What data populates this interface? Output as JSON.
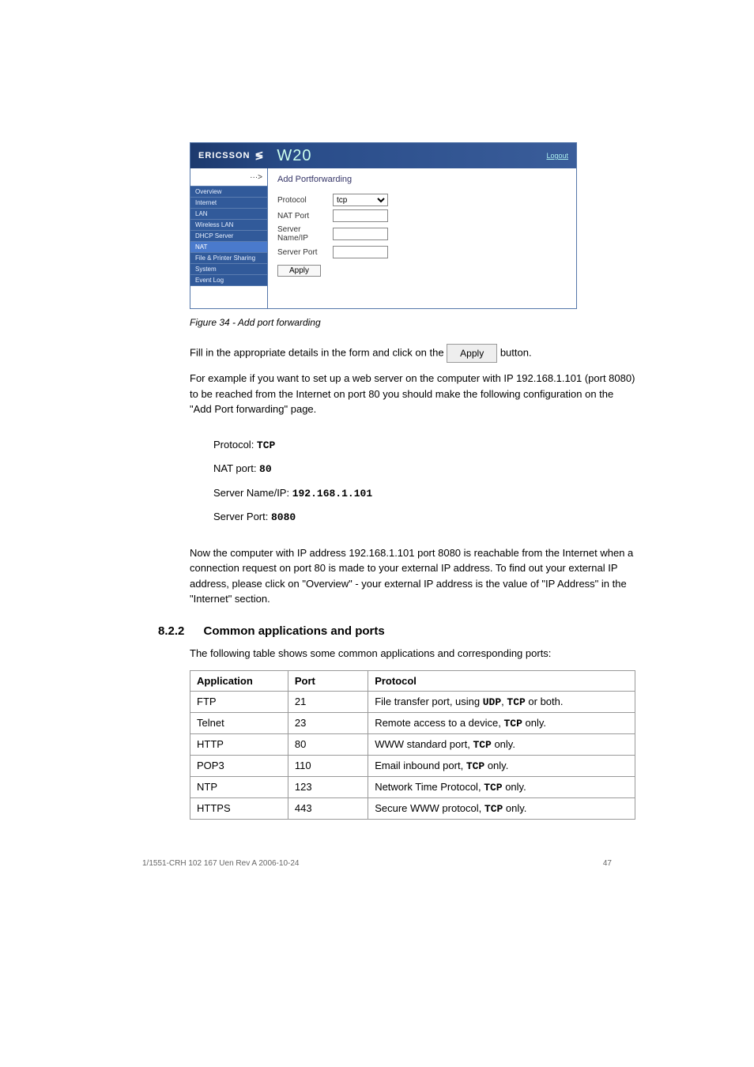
{
  "app": {
    "brand": "ERICSSON",
    "model": "W20",
    "logout": "Logout",
    "breadcrumb_glyph": "···>",
    "nav": [
      "Overview",
      "Internet",
      "LAN",
      "Wireless LAN",
      "DHCP Server",
      "NAT",
      "File & Printer Sharing",
      "System",
      "Event Log"
    ],
    "section_title": "Add Portforwarding",
    "form": {
      "protocol_label": "Protocol",
      "protocol_value": "tcp",
      "nat_port_label": "NAT Port",
      "server_name_label": "Server Name/IP",
      "server_port_label": "Server Port",
      "apply_label": "Apply"
    }
  },
  "caption": "Figure 34 - Add port forwarding",
  "doc": {
    "p1_a": "Fill in the appropriate details in the form and click on the ",
    "p1_btn": "Apply",
    "p1_b": " button.",
    "p2": "For example if you want to set up a web server on the computer with IP 192.168.1.101 (port 8080) to be reached from the Internet on port 80 you should make the following configuration on the \"Add Port forwarding\" page.",
    "ex": {
      "proto_label": "Protocol: ",
      "proto_val": "TCP",
      "nat_label": "NAT port: ",
      "nat_val": "80",
      "srv_label": "Server Name/IP: ",
      "srv_val": "192.168.1.101",
      "sp_label": "Server Port: ",
      "sp_val": "8080"
    },
    "p3": "Now the computer with IP address 192.168.1.101 port 8080 is reachable from the Internet when a connection request on port 80 is made to your external IP address. To find out your external IP address, please click on \"Overview\" - your external IP address is the value of \"IP Address\" in the \"Internet\" section.",
    "p4": "The following table shows some common applications and corresponding ports:"
  },
  "heading": {
    "num": "8.2.2",
    "text": "Common applications and ports"
  },
  "table": {
    "h1": "Application",
    "h2": "Port",
    "h3": "Protocol",
    "rows": [
      {
        "a": "FTP",
        "p": "21",
        "pr_a": "File transfer port, using ",
        "pr_udp": "UDP",
        "pr_mid": ", ",
        "pr_tcp": "TCP",
        "pr_b": " or both."
      },
      {
        "a": "Telnet",
        "p": "23",
        "pr_a": "Remote access to a device, ",
        "pr_tcp": "TCP",
        "pr_b": " only."
      },
      {
        "a": "HTTP",
        "p": "80",
        "pr_a": "WWW standard port, ",
        "pr_tcp": "TCP",
        "pr_b": " only."
      },
      {
        "a": "POP3",
        "p": "110",
        "pr_a": "Email inbound port, ",
        "pr_tcp": "TCP",
        "pr_b": " only."
      },
      {
        "a": "NTP",
        "p": "123",
        "pr_a": "Network Time Protocol, ",
        "pr_tcp": "TCP",
        "pr_b": " only."
      },
      {
        "a": "HTTPS",
        "p": "443",
        "pr_a": "Secure WWW protocol, ",
        "pr_tcp": "TCP",
        "pr_b": " only."
      }
    ]
  },
  "footer": {
    "left": "1/1551-CRH 102 167 Uen Rev A 2006-10-24",
    "right": "47"
  }
}
